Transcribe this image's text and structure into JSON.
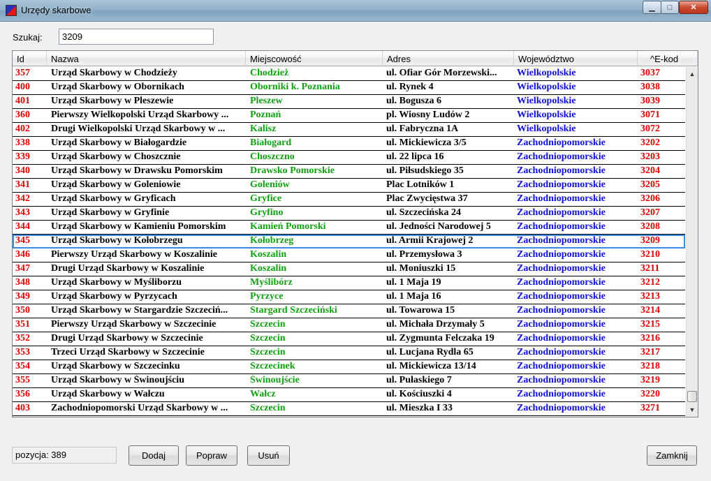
{
  "window": {
    "title": "Urzędy skarbowe",
    "minimize": "▁",
    "maximize": "□",
    "close": "✕"
  },
  "search": {
    "label": "Szukaj:",
    "value": "3209"
  },
  "columns": [
    {
      "key": "id",
      "label": "Id"
    },
    {
      "key": "name",
      "label": "Nazwa"
    },
    {
      "key": "city",
      "label": "Miejscowość"
    },
    {
      "key": "addr",
      "label": "Adres"
    },
    {
      "key": "woj",
      "label": "Województwo"
    },
    {
      "key": "ekod",
      "label": "^E-kod"
    }
  ],
  "selected_row": 12,
  "rows": [
    [
      "357",
      "Urząd Skarbowy w Chodzieży",
      "Chodzież",
      "ul. Ofiar Gór Morzewski...",
      "Wielkopolskie",
      "3037"
    ],
    [
      "400",
      "Urząd Skarbowy w Obornikach",
      "Oborniki k. Poznania",
      "ul. Rynek 4",
      "Wielkopolskie",
      "3038"
    ],
    [
      "401",
      "Urząd Skarbowy w Pleszewie",
      "Pleszew",
      "ul. Bogusza 6",
      "Wielkopolskie",
      "3039"
    ],
    [
      "360",
      "Pierwszy Wielkopolski Urząd Skarbowy ...",
      "Poznań",
      "pl. Wiosny Ludów 2",
      "Wielkopolskie",
      "3071"
    ],
    [
      "402",
      "Drugi Wielkopolski Urząd Skarbowy w ...",
      "Kalisz",
      "ul. Fabryczna 1A",
      "Wielkopolskie",
      "3072"
    ],
    [
      "338",
      "Urząd Skarbowy w Białogardzie",
      "Białogard",
      "ul. Mickiewicza 3/5",
      "Zachodniopomorskie",
      "3202"
    ],
    [
      "339",
      "Urząd Skarbowy w Choszcznie",
      "Choszczno",
      "ul. 22 lipca 16",
      "Zachodniopomorskie",
      "3203"
    ],
    [
      "340",
      "Urząd Skarbowy w Drawsku Pomorskim",
      "Drawsko Pomorskie",
      "ul. Piłsudskiego 35",
      "Zachodniopomorskie",
      "3204"
    ],
    [
      "341",
      "Urząd Skarbowy w Goleniowie",
      "Goleniów",
      "Plac Lotników 1",
      "Zachodniopomorskie",
      "3205"
    ],
    [
      "342",
      "Urząd Skarbowy w Gryficach",
      "Gryfice",
      "Plac Zwycięstwa 37",
      "Zachodniopomorskie",
      "3206"
    ],
    [
      "343",
      "Urząd Skarbowy w Gryfinie",
      "Gryfino",
      "ul. Szczecińska 24",
      "Zachodniopomorskie",
      "3207"
    ],
    [
      "344",
      "Urząd Skarbowy w Kamieniu Pomorskim",
      "Kamień Pomorski",
      "ul. Jedności Narodowej 5",
      "Zachodniopomorskie",
      "3208"
    ],
    [
      "345",
      "Urząd Skarbowy w Kołobrzegu",
      "Kołobrzeg",
      "ul. Armii Krajowej 2",
      "Zachodniopomorskie",
      "3209"
    ],
    [
      "346",
      "Pierwszy Urząd Skarbowy w Koszalinie",
      "Koszalin",
      "ul. Przemysłowa 3",
      "Zachodniopomorskie",
      "3210"
    ],
    [
      "347",
      "Drugi Urząd Skarbowy w Koszalinie",
      "Koszalin",
      "ul. Moniuszki 15",
      "Zachodniopomorskie",
      "3211"
    ],
    [
      "348",
      "Urząd Skarbowy w Myśliborzu",
      "Myślibórz",
      "ul. 1 Maja 19",
      "Zachodniopomorskie",
      "3212"
    ],
    [
      "349",
      "Urząd Skarbowy w Pyrzycach",
      "Pyrzyce",
      "ul. 1 Maja 16",
      "Zachodniopomorskie",
      "3213"
    ],
    [
      "350",
      "Urząd Skarbowy w Stargardzie Szczeciń...",
      "Stargard Szczeciński",
      "ul. Towarowa 15",
      "Zachodniopomorskie",
      "3214"
    ],
    [
      "351",
      "Pierwszy Urząd Skarbowy w Szczecinie",
      "Szczecin",
      "ul. Michała Drzymały 5",
      "Zachodniopomorskie",
      "3215"
    ],
    [
      "352",
      "Drugi Urząd Skarbowy w Szczecinie",
      "Szczecin",
      "ul. Zygmunta Felczaka 19",
      "Zachodniopomorskie",
      "3216"
    ],
    [
      "353",
      "Trzeci Urząd Skarbowy w Szczecinie",
      "Szczecin",
      "ul. Lucjana Rydla 65",
      "Zachodniopomorskie",
      "3217"
    ],
    [
      "354",
      "Urząd Skarbowy w Szczecinku",
      "Szczecinek",
      "ul. Mickiewicza 13/14",
      "Zachodniopomorskie",
      "3218"
    ],
    [
      "355",
      "Urząd Skarbowy w Świnoujściu",
      "Świnoujście",
      "ul. Pułaskiego 7",
      "Zachodniopomorskie",
      "3219"
    ],
    [
      "356",
      "Urząd Skarbowy w Wałczu",
      "Wałcz",
      "ul. Kościuszki 4",
      "Zachodniopomorskie",
      "3220"
    ],
    [
      "403",
      "Zachodniopomorski Urząd Skarbowy w ...",
      "Szczecin",
      "ul. Mieszka I 33",
      "Zachodniopomorskie",
      "3271"
    ]
  ],
  "scrollbar": {
    "up": "▲",
    "down": "▼"
  },
  "status": {
    "text": "pozycja:  389"
  },
  "buttons": {
    "add": "Dodaj",
    "edit": "Popraw",
    "delete": "Usuń",
    "close": "Zamknij"
  },
  "colors": {
    "id": "#e00000",
    "city": "#10a010",
    "woj": "#1010d8",
    "ekod": "#e00000",
    "selection": "#3d8be0"
  }
}
